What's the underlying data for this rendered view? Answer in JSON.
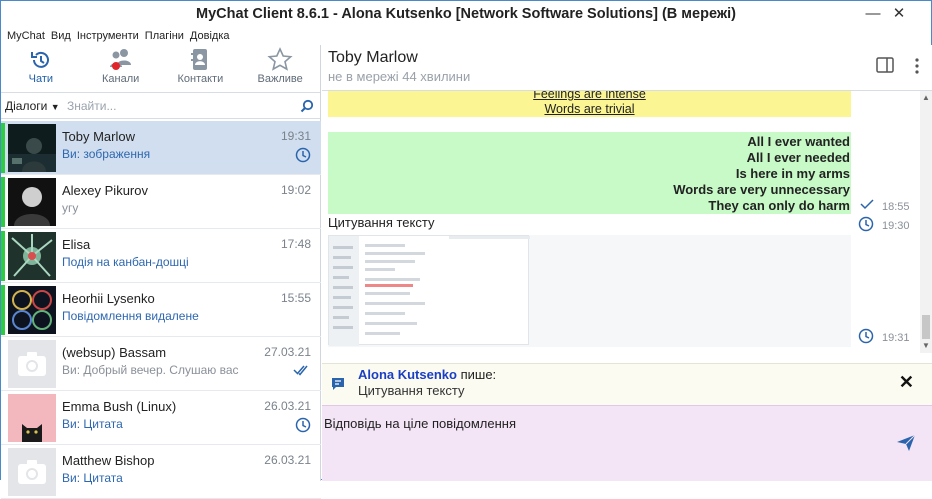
{
  "window": {
    "title": "MyChat Client 8.6.1 - Alona Kutsenko [Network Software Solutions] (В мережі)"
  },
  "menu": [
    "MyChat",
    "Вид",
    "Інструменти",
    "Плагіни",
    "Довідка"
  ],
  "nav_tabs": [
    {
      "label": "Чати",
      "icon": "history-clock-icon",
      "active": true
    },
    {
      "label": "Канали",
      "icon": "channels-people-icon",
      "active": false
    },
    {
      "label": "Контакти",
      "icon": "contacts-book-icon",
      "active": false
    },
    {
      "label": "Важливе",
      "icon": "star-icon",
      "active": false
    }
  ],
  "filter": {
    "selected": "Діалоги",
    "placeholder": "Знайти..."
  },
  "contacts": [
    {
      "name": "Toby Marlow",
      "time": "19:31",
      "sub": "Ви: зображення",
      "status_color": "#2ecc40",
      "state_icon": "clock-icon",
      "active": true
    },
    {
      "name": "Alexey Pikurov",
      "time": "19:02",
      "sub": "угу",
      "status_color": "#2ecc40",
      "state_icon": "",
      "active": false
    },
    {
      "name": "Elisa",
      "time": "17:48",
      "sub": "Подія на канбан-дошці",
      "status_color": "#2ecc40",
      "state_icon": "",
      "active": false
    },
    {
      "name": "Heorhii Lysenko",
      "time": "15:55",
      "sub": "Повідомлення видалене",
      "status_color": "#2ecc40",
      "state_icon": "",
      "active": false
    },
    {
      "name": "(websup) Bassam",
      "time": "27.03.21",
      "sub": "Ви: Добрый вечер. Слушаю вас",
      "status_color": "",
      "state_icon": "double-check-icon",
      "active": false
    },
    {
      "name": "Emma Bush (Linux)",
      "time": "26.03.21",
      "sub": "Ви: Цитата",
      "status_color": "",
      "state_icon": "clock-icon",
      "active": false
    },
    {
      "name": "Matthew Bishop",
      "time": "26.03.21",
      "sub": "Ви: Цитата",
      "status_color": "",
      "state_icon": "",
      "active": false
    }
  ],
  "chat": {
    "name": "Toby Marlow",
    "status": "не в мережі 44 хвилини",
    "yellow_lines": [
      "Feelings are intense",
      "Words are trivial"
    ],
    "green_lines": [
      "All I ever wanted",
      "All I ever needed",
      "Is here in my arms",
      "Words are very unnecessary",
      "They can only do harm"
    ],
    "green_time": "18:55",
    "quote_text": "Цитування тексту",
    "quote_time": "19:30",
    "image_time": "19:31"
  },
  "reply": {
    "author": "Alona Kutsenko",
    "verb": "пише:",
    "text": "Цитування тексту"
  },
  "compose": {
    "value": "Відповідь на ціле повідомлення"
  }
}
